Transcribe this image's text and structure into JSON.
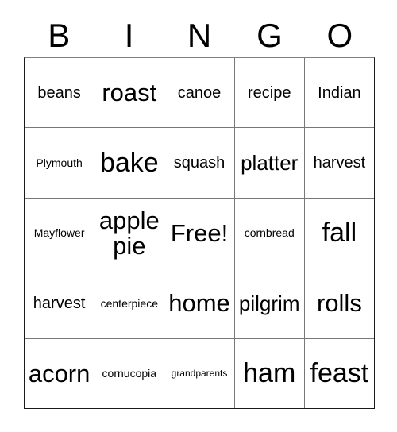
{
  "card": {
    "title": "BINGO",
    "header_letters": [
      "B",
      "I",
      "N",
      "G",
      "O"
    ],
    "free_space": "Free!",
    "colors": {
      "background": "#ffffff",
      "text": "#000000",
      "grid_line": "#777777",
      "grid_outer_border": "#1a1a1a"
    },
    "grid": {
      "columns": 5,
      "rows": 5,
      "cells": [
        [
          {
            "text": "beans",
            "size": "md"
          },
          {
            "text": "roast",
            "size": "xl"
          },
          {
            "text": "canoe",
            "size": "md"
          },
          {
            "text": "recipe",
            "size": "md"
          },
          {
            "text": "Indian",
            "size": "md"
          }
        ],
        [
          {
            "text": "Plymouth",
            "size": "sm"
          },
          {
            "text": "bake",
            "size": "xxl"
          },
          {
            "text": "squash",
            "size": "md"
          },
          {
            "text": "platter",
            "size": "lg"
          },
          {
            "text": "harvest",
            "size": "md"
          }
        ],
        [
          {
            "text": "Mayflower",
            "size": "sm"
          },
          {
            "text": "apple pie",
            "size": "xl"
          },
          {
            "text": "Free!",
            "size": "xl"
          },
          {
            "text": "cornbread",
            "size": "sm"
          },
          {
            "text": "fall",
            "size": "xxl"
          }
        ],
        [
          {
            "text": "harvest",
            "size": "md"
          },
          {
            "text": "centerpiece",
            "size": "sm"
          },
          {
            "text": "home",
            "size": "xl"
          },
          {
            "text": "pilgrim",
            "size": "lg"
          },
          {
            "text": "rolls",
            "size": "xl"
          }
        ],
        [
          {
            "text": "acorn",
            "size": "xl"
          },
          {
            "text": "cornucopia",
            "size": "sm"
          },
          {
            "text": "grandparents",
            "size": "xs"
          },
          {
            "text": "ham",
            "size": "xxl"
          },
          {
            "text": "feast",
            "size": "xxl"
          }
        ]
      ]
    }
  }
}
